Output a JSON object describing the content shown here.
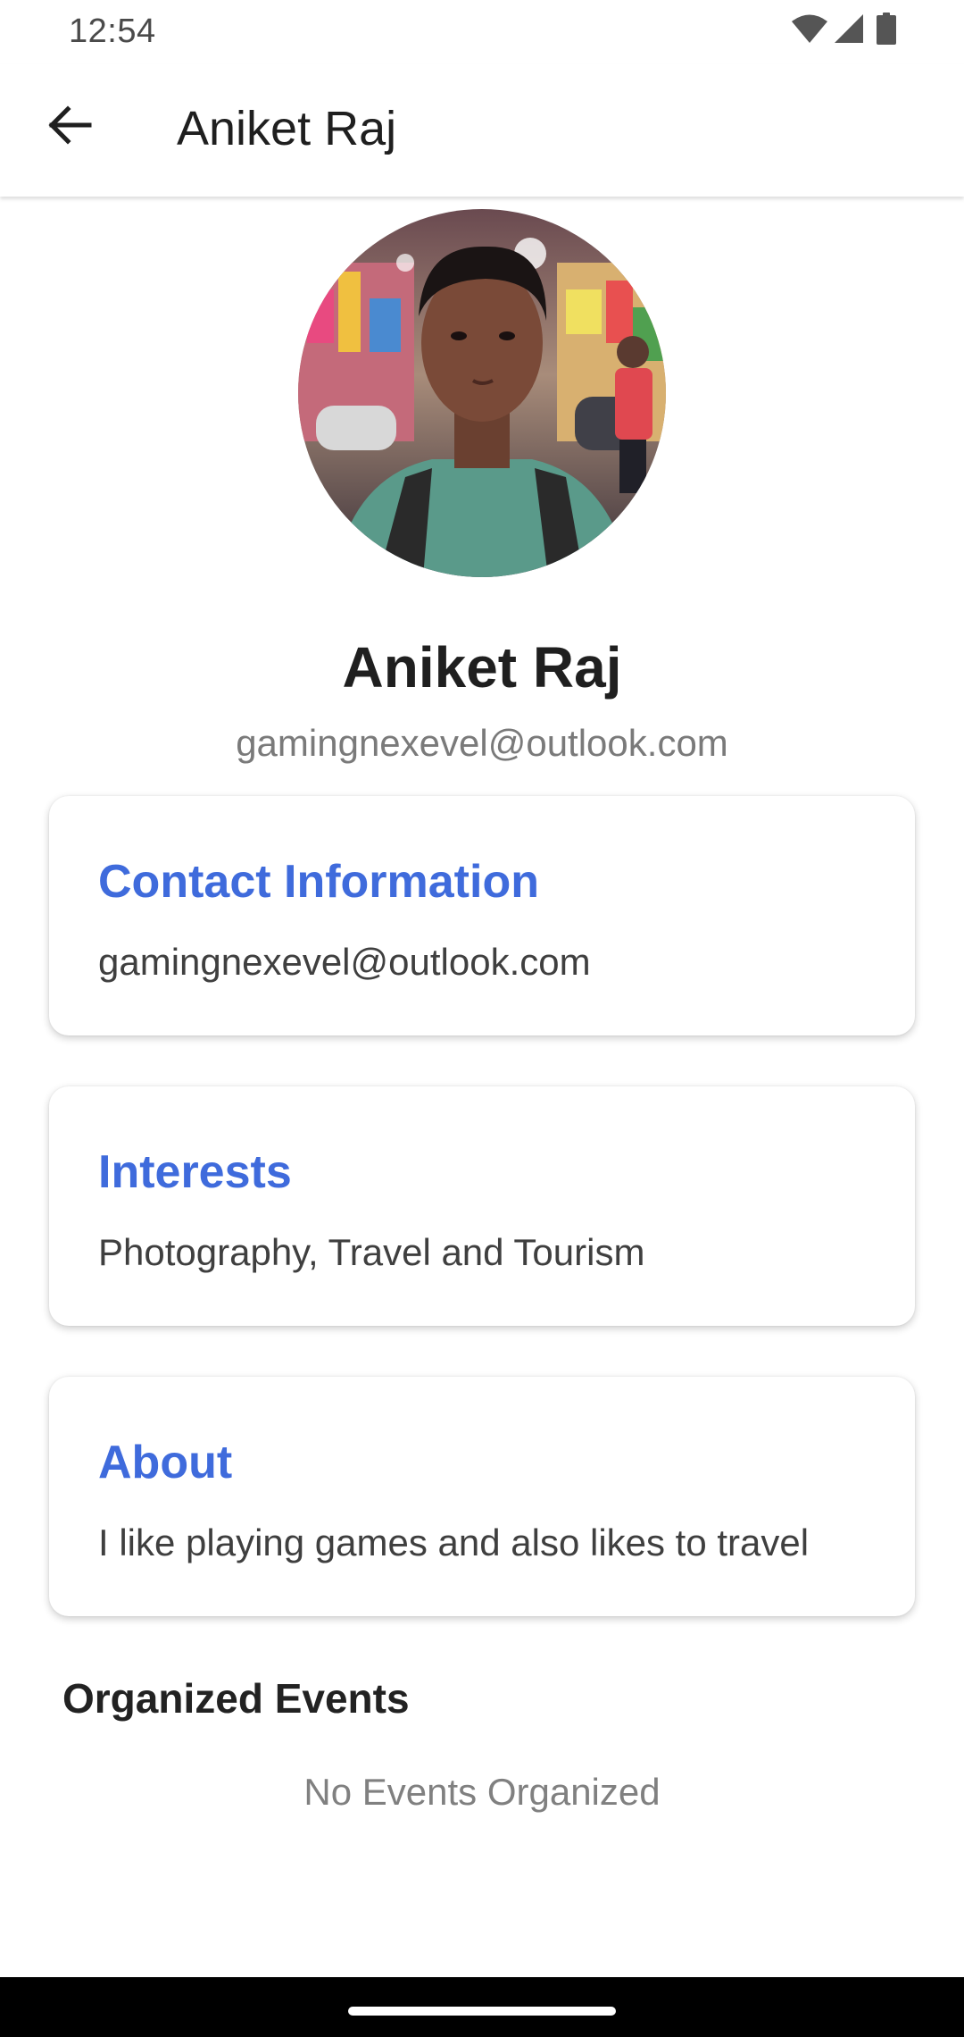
{
  "status_bar": {
    "time": "12:54",
    "icons": [
      "wifi-icon",
      "cellular-signal-icon",
      "battery-icon"
    ]
  },
  "app_bar": {
    "back_icon": "arrow-back-icon",
    "title": "Aniket Raj"
  },
  "profile": {
    "name": "Aniket Raj",
    "email": "gamingnexevel@outlook.com",
    "avatar": "profile-photo"
  },
  "cards": {
    "contact": {
      "title": "Contact Information",
      "body": "gamingnexevel@outlook.com"
    },
    "interests": {
      "title": "Interests",
      "body": "Photography, Travel and Tourism"
    },
    "about": {
      "title": "About",
      "body": "I like playing games and also likes to travel"
    }
  },
  "events": {
    "heading": "Organized Events",
    "empty_text": "No Events Organized"
  },
  "colors": {
    "accent": "#3f6bdc",
    "text_primary": "#1f1f1f",
    "text_secondary": "#7a7a7a"
  }
}
